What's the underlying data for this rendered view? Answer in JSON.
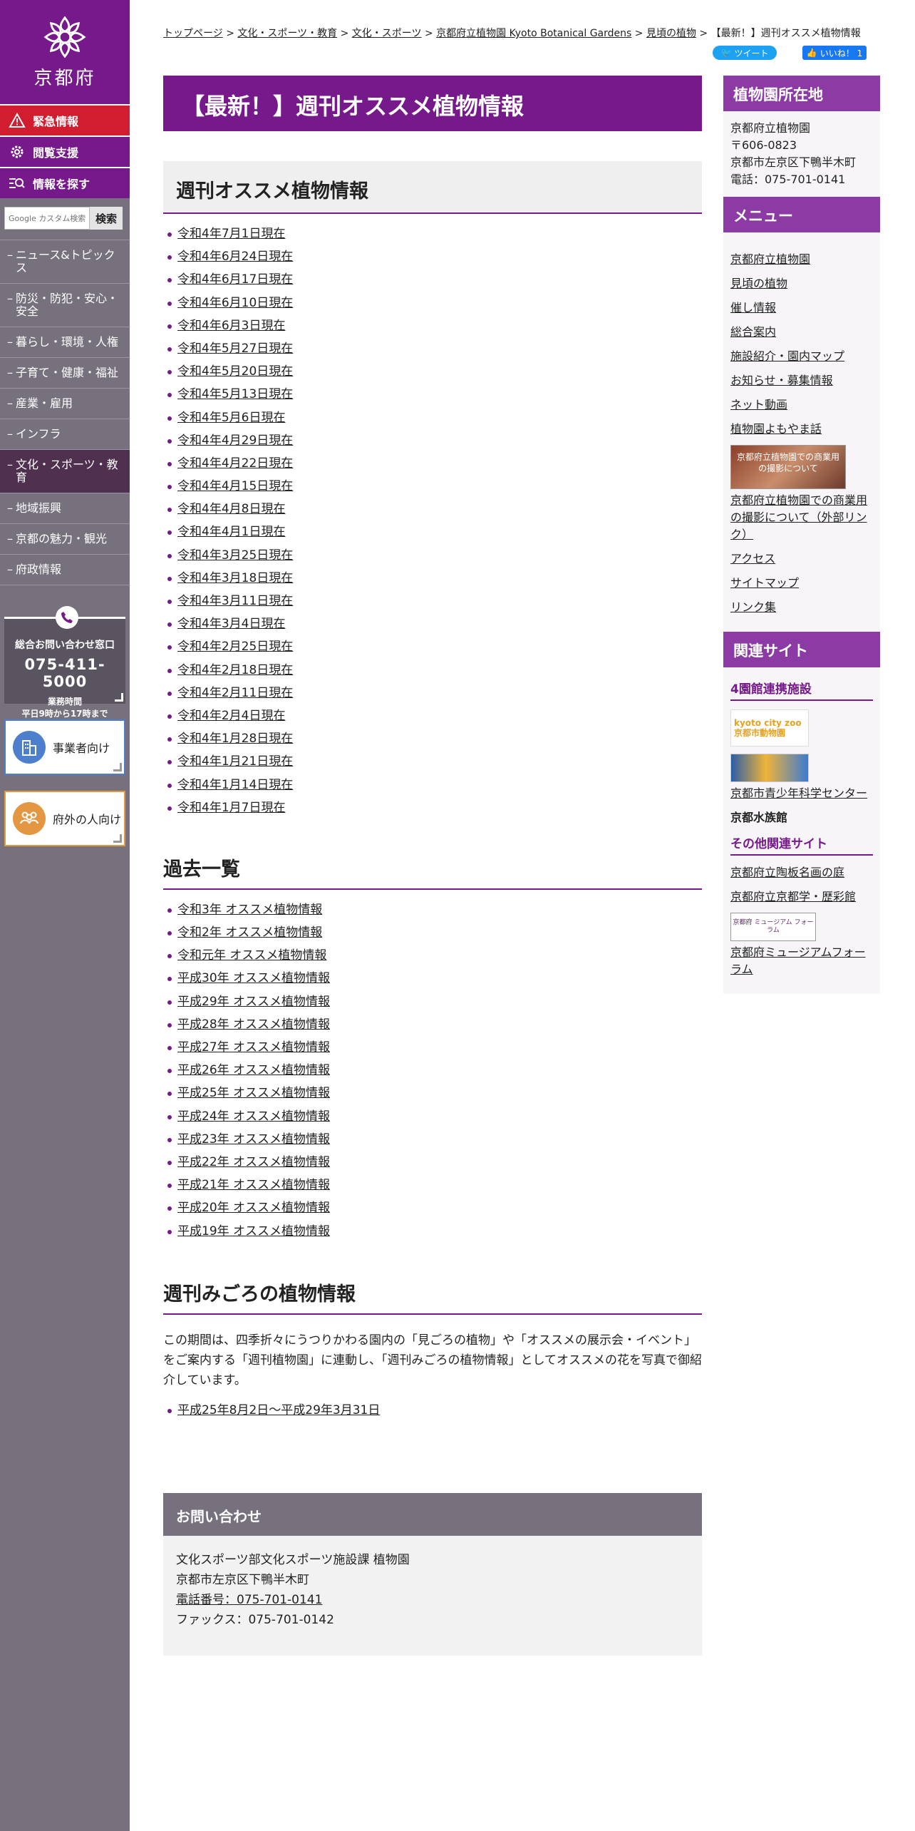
{
  "sidebar": {
    "logo_text": "京都府",
    "emergency": "緊急情報",
    "viewing": "閲覧支援",
    "find": "情報を探す",
    "search_placeholder": "Google カスタム検索",
    "search_button": "検索",
    "nav": [
      {
        "label": "ニュース&トピックス"
      },
      {
        "label": "防災・防犯・安心・安全"
      },
      {
        "label": "暮らし・環境・人権"
      },
      {
        "label": "子育て・健康・福祉"
      },
      {
        "label": "産業・雇用"
      },
      {
        "label": "インフラ"
      },
      {
        "label": "文化・スポーツ・教育"
      },
      {
        "label": "地域振興"
      },
      {
        "label": "京都の魅力・観光"
      },
      {
        "label": "府政情報"
      }
    ],
    "contact": {
      "title": "総合お問い合わせ窓口",
      "phone": "075-411-5000",
      "hours_label": "業務時間",
      "hours": "平日9時から17時まで"
    },
    "business": "事業者向け",
    "outside": "府外の人向け"
  },
  "breadcrumb": {
    "items": [
      "トップページ",
      "文化・スポーツ・教育",
      "文化・スポーツ",
      "京都府立植物園 Kyoto Botanical Gardens",
      "見頃の植物"
    ],
    "current": "【最新！】週刊オススメ植物情報",
    "sep": ">"
  },
  "social": {
    "tweet": "ツイート",
    "like": "いいね！ 1"
  },
  "main": {
    "title": "【最新！】週刊オススメ植物情報",
    "section1_heading": "週刊オススメ植物情報",
    "weekly_links": [
      "令和4年7月1日現在",
      "令和4年6月24日現在",
      "令和4年6月17日現在",
      "令和4年6月10日現在",
      "令和4年6月3日現在",
      "令和4年5月27日現在",
      "令和4年5月20日現在",
      "令和4年5月13日現在",
      "令和4年5月6日現在",
      "令和4年4月29日現在",
      "令和4年4月22日現在",
      "令和4年4月15日現在",
      "令和4年4月8日現在",
      "令和4年4月1日現在",
      "令和4年3月25日現在",
      "令和4年3月18日現在",
      "令和4年3月11日現在",
      "令和4年3月4日現在",
      "令和4年2月25日現在",
      "令和4年2月18日現在",
      "令和4年2月11日現在",
      "令和4年2月4日現在",
      "令和4年1月28日現在",
      "令和4年1月21日現在",
      "令和4年1月14日現在",
      "令和4年1月7日現在"
    ],
    "section2_heading": "過去一覧",
    "past_links": [
      "令和3年 オススメ植物情報",
      "令和2年 オススメ植物情報",
      "令和元年 オススメ植物情報",
      "平成30年 オススメ植物情報",
      "平成29年 オススメ植物情報",
      "平成28年 オススメ植物情報",
      "平成27年 オススメ植物情報",
      "平成26年 オススメ植物情報",
      "平成25年 オススメ植物情報",
      "平成24年 オススメ植物情報",
      "平成23年 オススメ植物情報",
      "平成22年 オススメ植物情報",
      "平成21年 オススメ植物情報",
      "平成20年 オススメ植物情報",
      "平成19年 オススメ植物情報"
    ],
    "section3_heading": "週刊みごろの植物情報",
    "section3_text": "この期間は、四季折々にうつりかわる園内の「見ごろの植物」や「オススメの展示会・イベント」をご案内する「週刊植物園」に連動し、「週刊みごろの植物情報」としてオススメの花を写真で御紹介しています。",
    "section3_link": "平成25年8月2日～平成29年3月31日",
    "inquiry": {
      "heading": "お問い合わせ",
      "dept": "文化スポーツ部文化スポーツ施設課 植物園",
      "address": "京都市左京区下鴨半木町",
      "phone": "電話番号：075-701-0141",
      "fax": "ファックス：075-701-0142"
    }
  },
  "right": {
    "location_heading": "植物園所在地",
    "location": {
      "name": "京都府立植物園",
      "postal": "〒606-0823",
      "address": "京都市左京区下鴨半木町",
      "phone": "電話：075-701-0141"
    },
    "menu_heading": "メニュー",
    "menu": [
      "京都府立植物園",
      "見頃の植物",
      "催し情報",
      "総合案内",
      "施設紹介・園内マップ",
      "お知らせ・募集情報",
      "ネット動画",
      "植物園よもやま話"
    ],
    "photo_banner_text": "京都府立植物園での商業用の撮影について",
    "photo_link": "京都府立植物園での商業用の撮影について（外部リンク）",
    "menu2": [
      "アクセス",
      "サイトマップ",
      "リンク集"
    ],
    "related_heading": "関連サイト",
    "sub1": "4園館連携施設",
    "zoo_banner_text": "kyoto city zoo 京都市動物園",
    "science_link": "京都市青少年科学センター",
    "aquarium": "京都水族館",
    "sub2": "その他関連サイト",
    "other_links": [
      "京都府立陶板名画の庭",
      "京都府立京都学・歴彩館"
    ],
    "museum_banner_text": "京都府 ミュージアム フォーラム",
    "museum_link": "京都府ミュージアムフォーラム"
  }
}
